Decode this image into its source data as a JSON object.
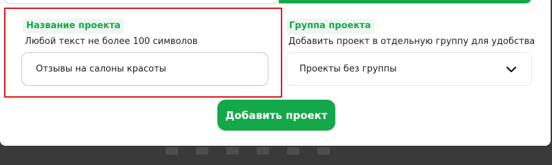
{
  "project_name": {
    "label": "Название проекта",
    "hint": "Любой текст не более 100 символов",
    "value": "Отзывы на салоны красоты"
  },
  "project_group": {
    "label": "Группа проекта",
    "hint": "Добавить проект в отдельную группу для удобства",
    "selected": "Проекты без группы",
    "icon": "chevron-down-icon"
  },
  "actions": {
    "submit_label": "Добавить проект"
  },
  "colors": {
    "accent": "#15a84a",
    "highlight": "#e0141a",
    "tag_bg": "#eef6ef"
  }
}
